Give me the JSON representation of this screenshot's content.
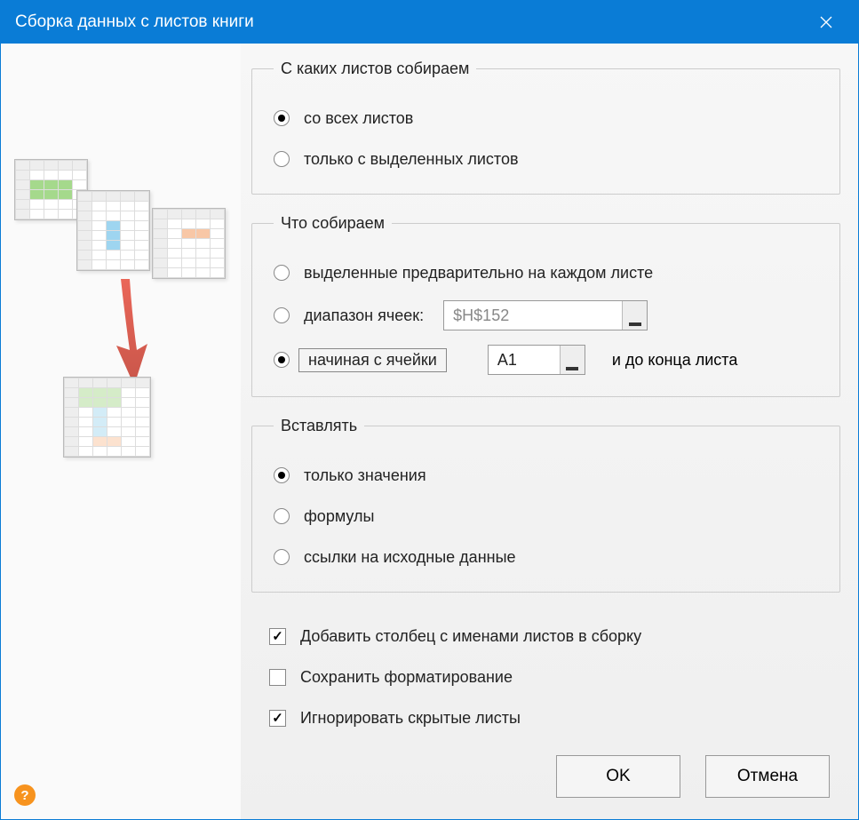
{
  "titlebar": {
    "title": "Сборка данных с листов книги"
  },
  "groups": {
    "source": {
      "legend": "С каких листов собираем",
      "opt_all": "со всех листов",
      "opt_selected": "только с выделенных листов"
    },
    "what": {
      "legend": "Что собираем",
      "opt_preselected": "выделенные предварительно на каждом листе",
      "opt_range": "диапазон ячеек:",
      "range_value": "$H$152",
      "opt_startcell": "начиная с ячейки",
      "startcell_value": "A1",
      "suffix": "и до конца листа"
    },
    "insert": {
      "legend": "Вставлять",
      "opt_values": "только значения",
      "opt_formulas": "формулы",
      "opt_links": "ссылки на исходные данные"
    }
  },
  "options": {
    "add_sheetname_col": "Добавить столбец с именами листов в сборку",
    "keep_formatting": "Сохранить форматирование",
    "ignore_hidden": "Игнорировать скрытые листы"
  },
  "buttons": {
    "ok": "OK",
    "cancel": "Отмена"
  },
  "help": "?"
}
